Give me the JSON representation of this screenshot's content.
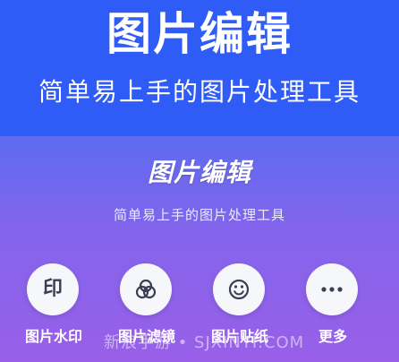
{
  "banner": {
    "title": "图片编辑",
    "subtitle": "简单易上手的图片处理工具"
  },
  "app": {
    "title": "图片编辑",
    "subtitle": "简单易上手的图片处理工具"
  },
  "features": [
    {
      "icon": "stamp-icon",
      "glyph": "印",
      "label": "图片水印"
    },
    {
      "icon": "filter-icon",
      "label": "图片滤镜"
    },
    {
      "icon": "sticker-icon",
      "label": "图片贴纸"
    },
    {
      "icon": "more-icon",
      "label": "更多"
    }
  ],
  "watermark": {
    "text": "新浪手游 • SJXINYI.COM"
  },
  "colors": {
    "banner": "#2f5bf6",
    "gradient_top": "#3f62f2",
    "gradient_bottom": "#9a5fe8",
    "button_bg": "#f6f7fb",
    "icon": "#3d3d55"
  }
}
